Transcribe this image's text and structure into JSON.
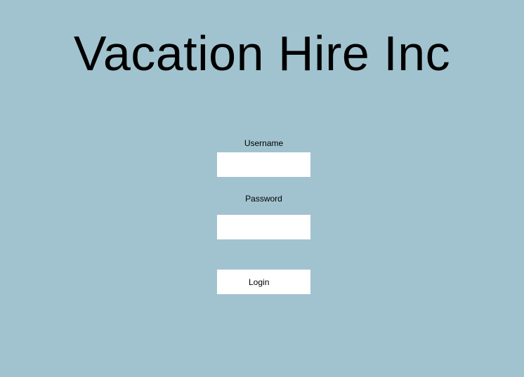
{
  "header": {
    "title": "Vacation Hire Inc"
  },
  "login_form": {
    "username_label": "Username",
    "username_value": "",
    "password_label": "Password",
    "password_value": "",
    "login_label": "Login"
  },
  "colors": {
    "background": "#a1c3cf",
    "field_background": "#ffffff",
    "text": "#000000"
  }
}
